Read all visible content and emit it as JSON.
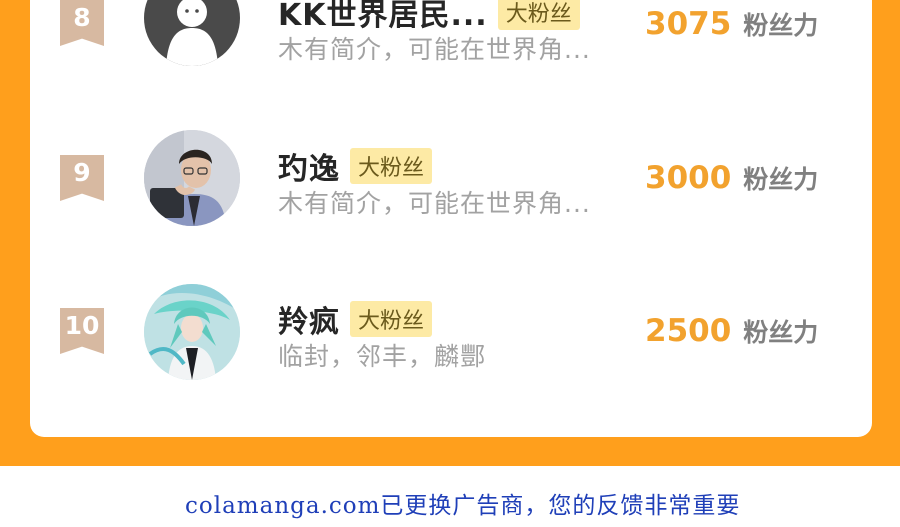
{
  "leaderboard": {
    "entries": [
      {
        "rank": "8",
        "name": "KK世界居民...",
        "tag": "大粉丝",
        "bio": "木有简介，可能在世界角...",
        "score": "3075",
        "unit": "粉丝力",
        "avatar": "default-person-avatar"
      },
      {
        "rank": "9",
        "name": "玓逸",
        "tag": "大粉丝",
        "bio": "木有简介，可能在世界角...",
        "score": "3000",
        "unit": "粉丝力",
        "avatar": "photo-avatar"
      },
      {
        "rank": "10",
        "name": "羚疯",
        "tag": "大粉丝",
        "bio": "临封，邻丰，麟酆",
        "score": "2500",
        "unit": "粉丝力",
        "avatar": "anime-character-avatar"
      }
    ]
  },
  "footer": {
    "text": "colamanga.com已更换广告商，您的反馈非常重要"
  },
  "colors": {
    "frame": "#ff9f1c",
    "score": "#f2a22e",
    "badge": "#d7b9a1",
    "tag_bg": "#fdeaa5",
    "link": "#1f3fb8"
  }
}
